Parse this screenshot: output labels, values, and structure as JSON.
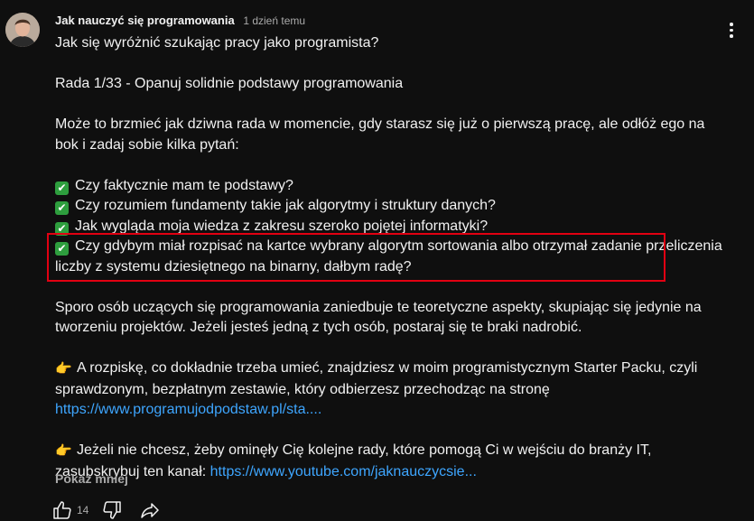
{
  "comment": {
    "author": "Jak nauczyć się programowania",
    "time": "1 dzień temu",
    "lines": {
      "q": "Jak się wyróżnić szukając pracy jako programista?",
      "rada": "Rada 1/33 - Opanuj solidnie podstawy programowania",
      "intro": "Może to brzmieć jak dziwna rada w momencie, gdy starasz się już o pierwszą pracę, ale odłóż ego na bok i zadaj sobie kilka pytań:",
      "c1": "Czy faktycznie mam te podstawy?",
      "c2": "Czy rozumiem fundamenty takie jak algorytmy i struktury danych?",
      "c3": "Jak wygląda moja wiedza z zakresu szeroko pojętej informatyki?",
      "c4": "Czy gdybym miał rozpisać na kartce wybrany algorytm sortowania albo otrzymał zadanie przeliczenia liczby z systemu dziesiętnego na binarny, dałbym radę?",
      "p2": "Sporo osób uczących się programowania zaniedbuje te teoretyczne aspekty, skupiając się jedynie na tworzeniu projektów. Jeżeli jesteś jedną z tych osób, postaraj się te braki nadrobić.",
      "p3": "A rozpiskę, co dokładnie trzeba umieć, znajdziesz w moim programistycznym Starter Packu, czyli sprawdzonym, bezpłatnym zestawie, który odbierzesz przechodząc na stronę",
      "link1": "https://www.programujodpodstaw.pl/sta....",
      "p4": "Jeżeli nie chcesz, żeby ominęły Cię kolejne rady, które pomogą Ci w wejściu do branży IT, zasubskrybuj ten kanał:",
      "link2": "https://www.youtube.com/jaknauczycsie..."
    },
    "show_less": "Pokaż mniej",
    "likes": "14"
  },
  "icons": {
    "check": "white-heavy-check-mark-icon",
    "point": "backhand-index-pointing-right-icon",
    "menu": "more-vert-icon",
    "like": "thumbs-up-icon",
    "dislike": "thumbs-down-icon",
    "share": "share-icon"
  },
  "colors": {
    "background": "#0f0f0f",
    "text": "#f1f1f1",
    "muted": "#aaaaaa",
    "link": "#3ea6ff",
    "check": "#2e9e3e",
    "highlight": "#e10012"
  }
}
